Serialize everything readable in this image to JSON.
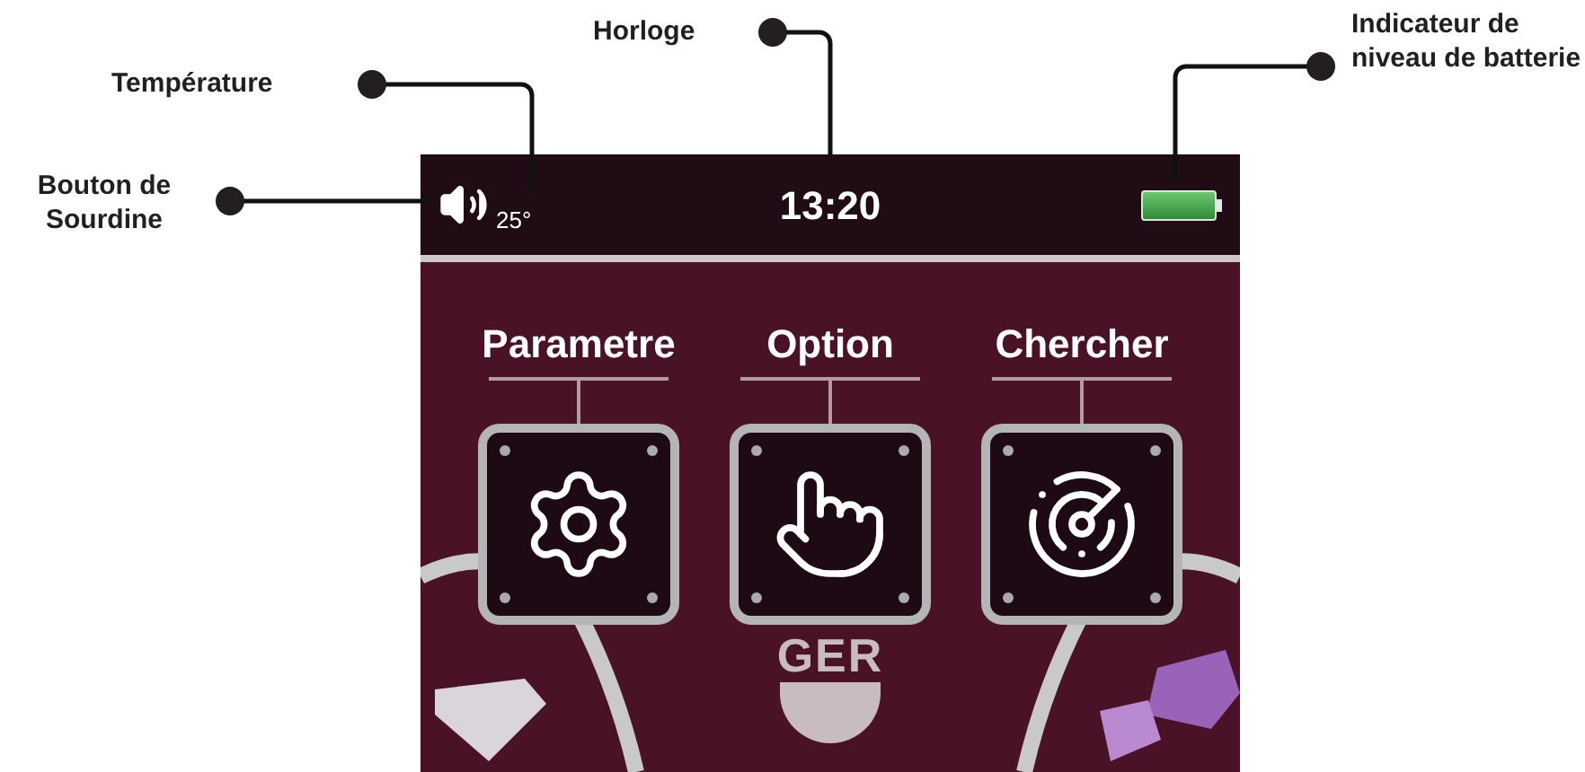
{
  "callouts": [
    {
      "text": "Horloge"
    },
    {
      "text": "Température"
    },
    {
      "text": "Bouton de Sourdine"
    },
    {
      "text": "Indicateur de niveau de batterie"
    }
  ],
  "status_bar": {
    "temperature": "25°",
    "clock": "13:20"
  },
  "menu": [
    {
      "label": "Parametre",
      "kind": "settings"
    },
    {
      "label": "Option",
      "kind": "touch"
    },
    {
      "label": "Chercher",
      "kind": "radar"
    }
  ],
  "logo": "GER"
}
